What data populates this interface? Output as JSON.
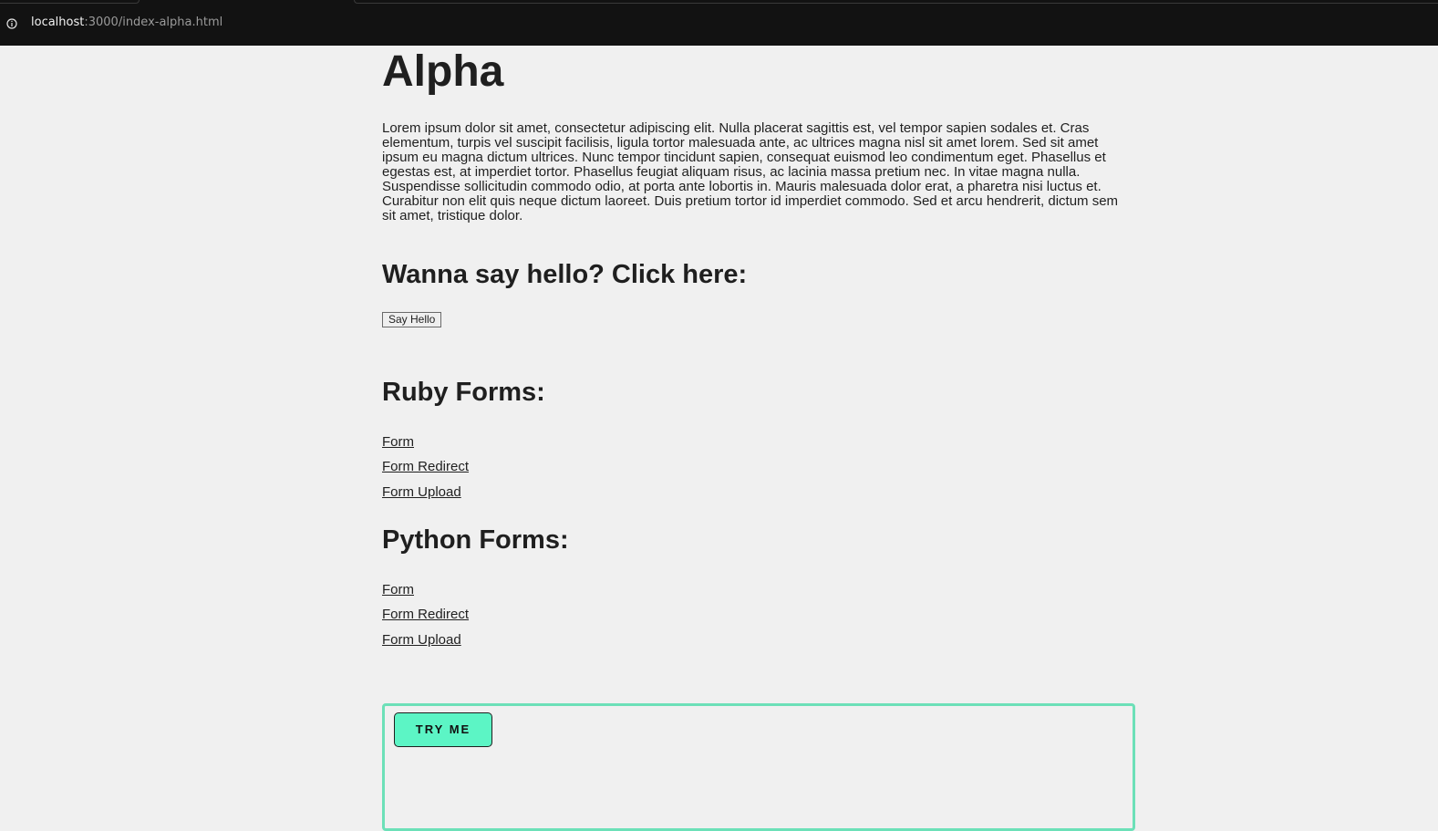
{
  "browser": {
    "url_host": "localhost",
    "url_path": ":3000/index-alpha.html"
  },
  "page": {
    "title": "Alpha",
    "paragraph": "Lorem ipsum dolor sit amet, consectetur adipiscing elit. Nulla placerat sagittis est, vel tempor sapien sodales et. Cras elementum, turpis vel suscipit facilisis, ligula tortor malesuada ante, ac ultrices magna nisl sit amet lorem. Sed sit amet ipsum eu magna dictum ultrices. Nunc tempor tincidunt sapien, consequat euismod leo condimentum eget. Phasellus et egestas est, at imperdiet tortor. Phasellus feugiat aliquam risus, ac lacinia massa pretium nec. In vitae magna nulla. Suspendisse sollicitudin commodo odio, at porta ante lobortis in. Mauris malesuada dolor erat, a pharetra nisi luctus et. Curabitur non elit quis neque dictum laoreet. Duis pretium tortor id imperdiet commodo. Sed et arcu hendrerit, dictum sem sit amet, tristique dolor.",
    "hello_heading": "Wanna say hello? Click here:",
    "hello_button": "Say Hello",
    "ruby": {
      "heading": "Ruby Forms:",
      "links": [
        "Form",
        "Form Redirect",
        "Form Upload"
      ]
    },
    "python": {
      "heading": "Python Forms:",
      "links": [
        "Form",
        "Form Redirect",
        "Form Upload"
      ]
    },
    "try_button": "TRY ME"
  },
  "colors": {
    "background": "#f0f0f0",
    "browser_bar": "#121212",
    "accent": "#5cf5c5",
    "panel_border": "#6ce0b8",
    "text": "#1f1f1f"
  }
}
